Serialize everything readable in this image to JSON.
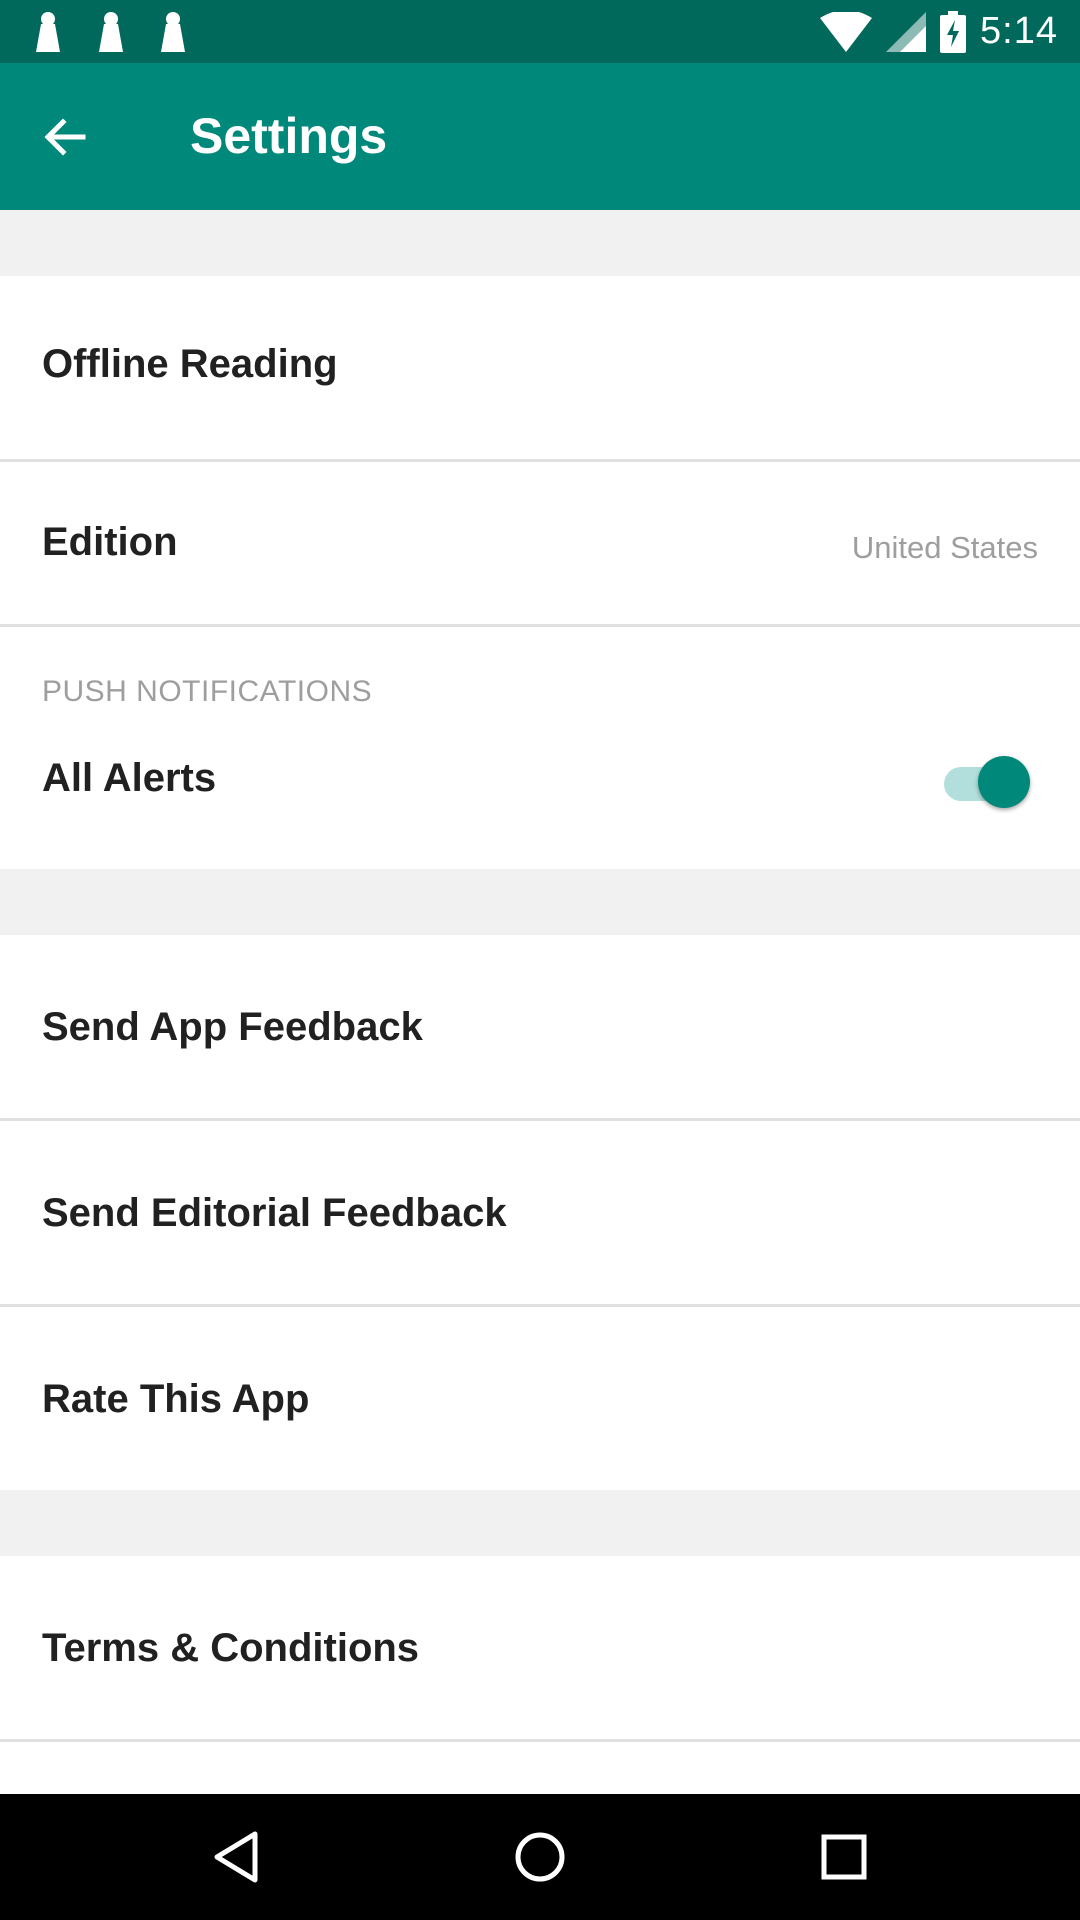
{
  "status_bar": {
    "time": "5:14",
    "notification_icons": [
      "notification-icon",
      "notification-icon",
      "notification-icon"
    ],
    "system_icons": [
      "wifi-icon",
      "cell-signal-icon",
      "battery-charging-icon"
    ]
  },
  "app_bar": {
    "title": "Settings",
    "back_icon": "arrow-back-icon"
  },
  "settings": {
    "offline_reading": {
      "label": "Offline Reading"
    },
    "edition": {
      "label": "Edition",
      "value": "United States"
    },
    "push_notifications": {
      "header": "PUSH NOTIFICATIONS",
      "all_alerts": {
        "label": "All Alerts",
        "enabled": true
      }
    },
    "send_app_feedback": {
      "label": "Send App Feedback"
    },
    "send_editorial_feedback": {
      "label": "Send Editorial Feedback"
    },
    "rate_this_app": {
      "label": "Rate This App"
    },
    "terms_conditions": {
      "label": "Terms & Conditions"
    }
  },
  "nav_bar": {
    "back_icon": "nav-back-icon",
    "home_icon": "nav-home-icon",
    "recents_icon": "nav-recents-icon"
  },
  "colors": {
    "status_bar": "#00695c",
    "app_bar": "#00897b",
    "accent": "#00897b",
    "divider": "#e0e0e0",
    "section_gap": "#f1f1f1"
  }
}
